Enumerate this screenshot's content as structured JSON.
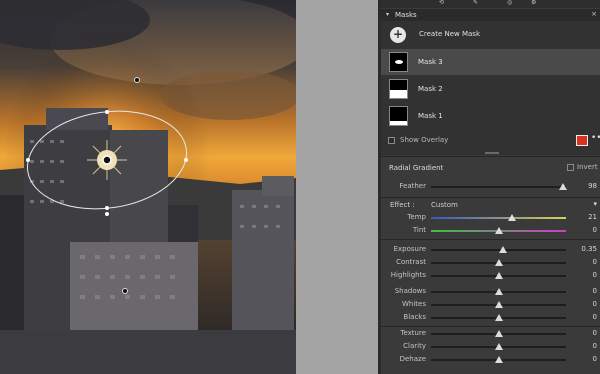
{
  "panel": {
    "top_icons": [
      "⟲",
      "✎",
      "◎",
      "⚙"
    ],
    "masks": {
      "title": "Masks",
      "create_label": "Create New Mask",
      "items": [
        {
          "label": "Mask 3",
          "selected": true
        },
        {
          "label": "Mask 2",
          "selected": false
        },
        {
          "label": "Mask 1",
          "selected": false
        }
      ],
      "show_overlay_label": "Show Overlay",
      "overlay_color": "#d9331f"
    },
    "radial": {
      "name": "Radial Gradient",
      "invert_label": "Invert",
      "feather_label": "Feather",
      "feather_value": "98",
      "feather_level": 0.98
    },
    "effect": {
      "label": "Effect :",
      "preset": "Custom"
    },
    "sliders": [
      {
        "id": "temp",
        "label": "Temp",
        "value": "21",
        "level": 0.6,
        "color": "temp"
      },
      {
        "id": "tint",
        "label": "Tint",
        "value": "0",
        "level": 0.5,
        "color": "tint"
      },
      {
        "id": "exposure",
        "label": "Exposure",
        "value": "0.35",
        "level": 0.535
      },
      {
        "id": "contrast",
        "label": "Contrast",
        "value": "0",
        "level": 0.5
      },
      {
        "id": "highlights",
        "label": "Highlights",
        "value": "0",
        "level": 0.5
      },
      {
        "id": "shadows",
        "label": "Shadows",
        "value": "0",
        "level": 0.5
      },
      {
        "id": "whites",
        "label": "Whites",
        "value": "0",
        "level": 0.5
      },
      {
        "id": "blacks",
        "label": "Blacks",
        "value": "0",
        "level": 0.5
      },
      {
        "id": "texture",
        "label": "Texture",
        "value": "0",
        "level": 0.5
      },
      {
        "id": "clarity",
        "label": "Clarity",
        "value": "0",
        "level": 0.5
      },
      {
        "id": "dehaze",
        "label": "Dehaze",
        "value": "0",
        "level": 0.5
      }
    ]
  }
}
